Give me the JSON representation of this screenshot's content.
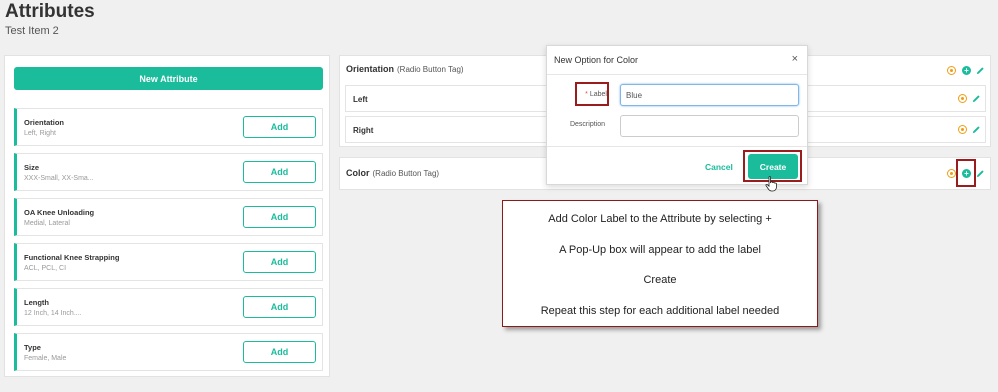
{
  "header": {
    "title": "Attributes",
    "subtitle": "Test Item 2"
  },
  "left_panel": {
    "new_button": "New Attribute",
    "attributes": [
      {
        "name": "Orientation",
        "values": "Left, Right",
        "add_label": "Add"
      },
      {
        "name": "Size",
        "values": "XXX-Small, XX-Sma...",
        "add_label": "Add"
      },
      {
        "name": "OA Knee Unloading",
        "values": "Medial, Lateral",
        "add_label": "Add"
      },
      {
        "name": "Functional Knee Strapping",
        "values": "ACL, PCL, CI",
        "add_label": "Add"
      },
      {
        "name": "Length",
        "values": "12 Inch, 14 Inch....",
        "add_label": "Add"
      },
      {
        "name": "Type",
        "values": "Female, Male",
        "add_label": "Add"
      }
    ]
  },
  "groups": {
    "orientation": {
      "title": "Orientation",
      "tag": "(Radio Button Tag)",
      "options": [
        {
          "label": "Left"
        },
        {
          "label": "Right"
        }
      ]
    },
    "color": {
      "title": "Color",
      "tag": "(Radio Button Tag)"
    }
  },
  "modal": {
    "title": "New Option for Color",
    "close": "×",
    "required_mark": "*",
    "label_field": "Label",
    "label_value": "Blue",
    "description_field": "Description",
    "description_value": "",
    "cancel": "Cancel",
    "create": "Create"
  },
  "instructions": [
    "Add Color Label to the Attribute by selecting +",
    "A Pop-Up box will appear to add the label",
    "Create",
    "Repeat this step for each additional label needed"
  ],
  "colors": {
    "accent": "#1abc9c",
    "remove": "#f39c12",
    "highlight": "#9b1c1c"
  },
  "icons": [
    "remove-icon",
    "add-icon",
    "edit-icon",
    "close-icon",
    "hand-cursor-icon"
  ]
}
